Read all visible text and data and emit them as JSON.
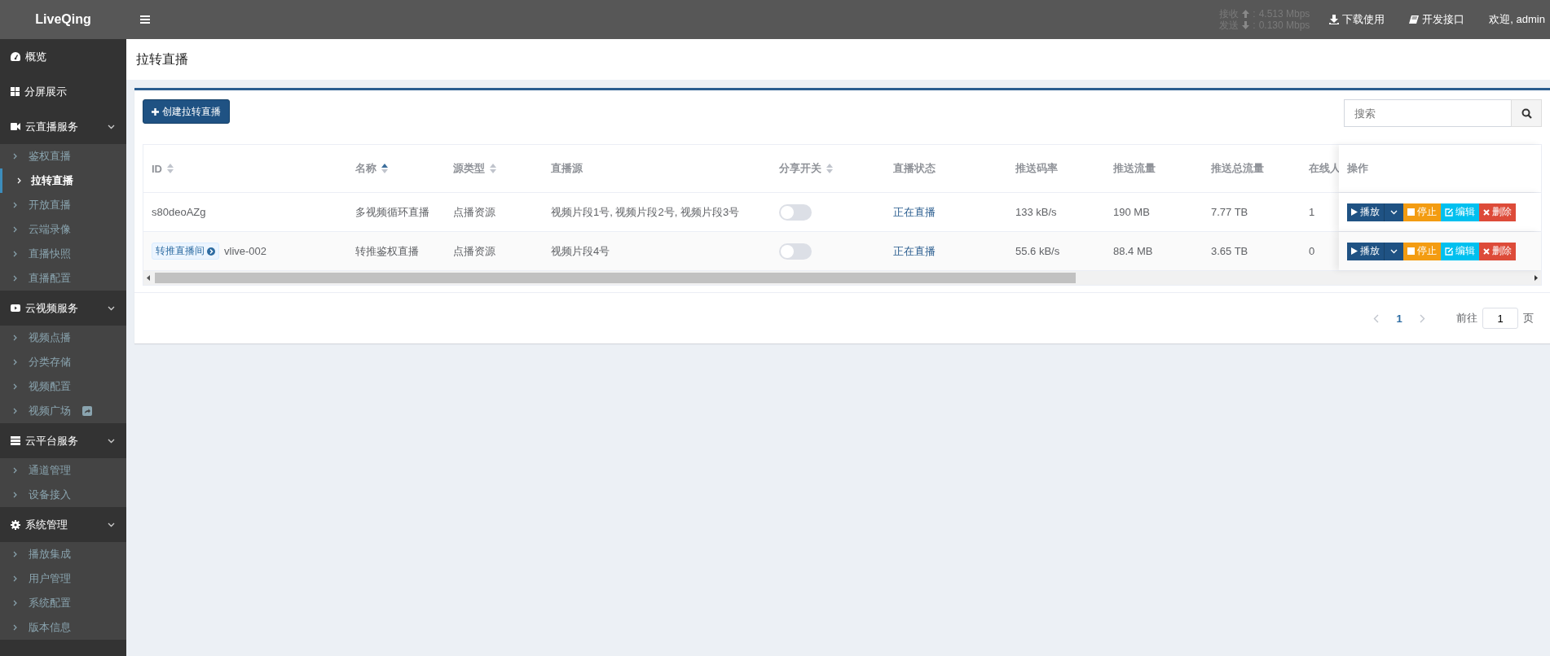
{
  "topbar": {
    "logo": "LiveQing",
    "stats": [
      {
        "label": "接收",
        "kind": "receive",
        "sep": ":",
        "value": "4.513 Mbps"
      },
      {
        "label": "发送",
        "kind": "send",
        "sep": ":",
        "value": "0.130 Mbps"
      }
    ],
    "links": [
      {
        "kind": "download",
        "label": "下载使用"
      },
      {
        "kind": "book",
        "label": "开发接口"
      }
    ],
    "welcome": "欢迎, admin"
  },
  "sidebar": {
    "items": [
      {
        "label": "概览"
      },
      {
        "label": "分屏展示"
      },
      {
        "label": "云直播服务",
        "expanded": true,
        "children": [
          {
            "label": "鉴权直播",
            "selected": false,
            "external": false
          },
          {
            "label": "拉转直播",
            "selected": true,
            "external": false
          },
          {
            "label": "开放直播",
            "selected": false,
            "external": false
          },
          {
            "label": "云端录像",
            "selected": false,
            "external": false
          },
          {
            "label": "直播快照",
            "selected": false,
            "external": false
          },
          {
            "label": "直播配置",
            "selected": false,
            "external": false
          }
        ]
      },
      {
        "label": "云视频服务",
        "expanded": true,
        "children": [
          {
            "label": "视频点播",
            "selected": false,
            "external": false
          },
          {
            "label": "分类存储",
            "selected": false,
            "external": false
          },
          {
            "label": "视频配置",
            "selected": false,
            "external": false
          },
          {
            "label": "视频广场",
            "selected": false,
            "external": true
          }
        ]
      },
      {
        "label": "云平台服务",
        "expanded": true,
        "children": [
          {
            "label": "通道管理",
            "selected": false,
            "external": false
          },
          {
            "label": "设备接入",
            "selected": false,
            "external": false
          }
        ]
      },
      {
        "label": "系统管理",
        "expanded": true,
        "children": [
          {
            "label": "播放集成",
            "selected": false,
            "external": false
          },
          {
            "label": "用户管理",
            "selected": false,
            "external": false
          },
          {
            "label": "系统配置",
            "selected": false,
            "external": false
          },
          {
            "label": "版本信息",
            "selected": false,
            "external": false
          }
        ]
      }
    ]
  },
  "page": {
    "title": "拉转直播",
    "create_button": "创建拉转直播",
    "search": {
      "placeholder": "搜索"
    }
  },
  "table": {
    "columns": [
      {
        "label": "ID",
        "sortable": true,
        "sorted": false
      },
      {
        "label": "名称",
        "sortable": true,
        "sorted": true
      },
      {
        "label": "源类型",
        "sortable": true,
        "sorted": false
      },
      {
        "label": "直播源"
      },
      {
        "label": "分享开关",
        "sortable": true,
        "sorted": false
      },
      {
        "label": "直播状态"
      },
      {
        "label": "推送码率"
      },
      {
        "label": "推送流量"
      },
      {
        "label": "推送总流量"
      },
      {
        "label": "在线人"
      },
      {
        "label": "操作"
      }
    ],
    "rows": [
      {
        "id": "s80deoAZg",
        "name": "多视频循环直播",
        "source_type": "点播资源",
        "source": "视频片段1号, 视频片段2号, 视频片段3号",
        "share_on": false,
        "status": "正在直播",
        "bitrate": "133 kB/s",
        "traffic": "190 MB",
        "total": "7.77 TB",
        "online": "1",
        "actions": [
          {
            "kind": "play",
            "label": "播放"
          },
          {
            "kind": "stop",
            "label": "停止"
          },
          {
            "kind": "edit",
            "label": "编辑"
          },
          {
            "kind": "delete",
            "label": "删除"
          }
        ]
      },
      {
        "tag": "转推直播间",
        "id": "vlive-002",
        "name": "转推鉴权直播",
        "source_type": "点播资源",
        "source": "视频片段4号",
        "share_on": false,
        "status": "正在直播",
        "bitrate": "55.6 kB/s",
        "traffic": "88.4 MB",
        "total": "3.65 TB",
        "online": "0",
        "actions": [
          {
            "kind": "play",
            "label": "播放"
          },
          {
            "kind": "stop",
            "label": "停止"
          },
          {
            "kind": "edit",
            "label": "编辑"
          },
          {
            "kind": "delete",
            "label": "删除"
          }
        ]
      }
    ]
  },
  "pagination": {
    "prev_disabled": true,
    "next_disabled": true,
    "pages": [
      {
        "label": "1",
        "selected": true
      }
    ],
    "goto_label": "前往",
    "goto_value": "1",
    "page_suffix": "页"
  }
}
